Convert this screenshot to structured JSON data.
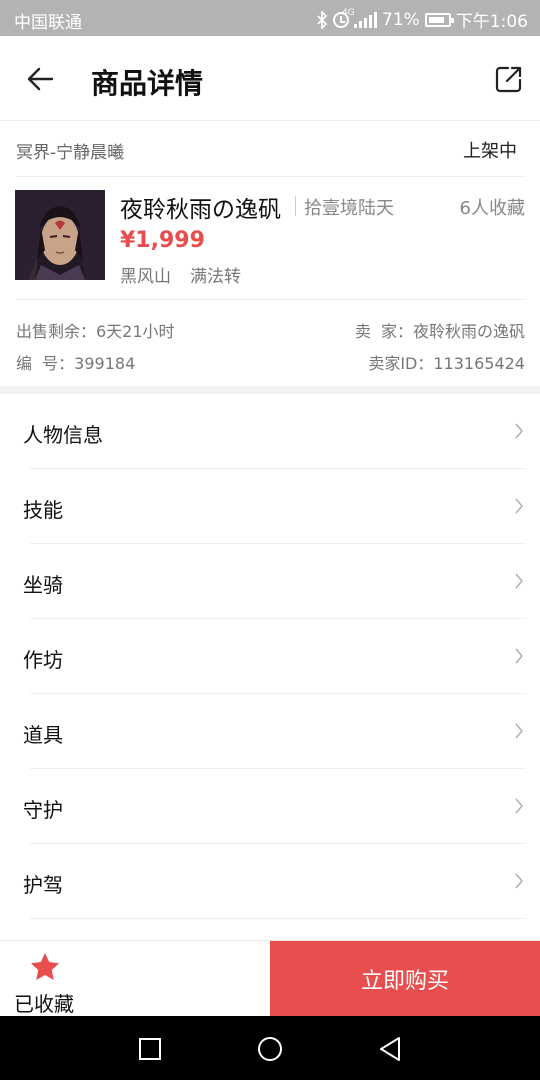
{
  "status_bar": {
    "carrier": "中国联通",
    "network": "4G",
    "battery": "71%",
    "time": "下午1:06"
  },
  "header": {
    "title": "商品详情",
    "back_icon": "arrow-left-icon",
    "share_icon": "share-external-icon"
  },
  "listing": {
    "server": "冥界-宁静晨曦",
    "status": "上架中",
    "name": "夜聆秋雨の逸矾",
    "zone": "拾壹境陆天",
    "favorites": "6人收藏",
    "price": "¥1,999",
    "tags": [
      "黑风山",
      "满法转"
    ],
    "time_left": "出售剩余：6天21小时",
    "seller": "卖  家：夜聆秋雨の逸矾",
    "serial": "编  号：399184",
    "seller_id": "卖家ID：113165424"
  },
  "menu": {
    "items": [
      {
        "label": "人物信息"
      },
      {
        "label": "技能"
      },
      {
        "label": "坐骑"
      },
      {
        "label": "作坊"
      },
      {
        "label": "道具"
      },
      {
        "label": "守护"
      },
      {
        "label": "护驾"
      }
    ]
  },
  "bottom_bar": {
    "fav_label": "已收藏",
    "buy_label": "立即购买"
  },
  "colors": {
    "accent": "#e84e4e",
    "price": "#e84c4c",
    "status_bar": "#b3b3b3"
  }
}
